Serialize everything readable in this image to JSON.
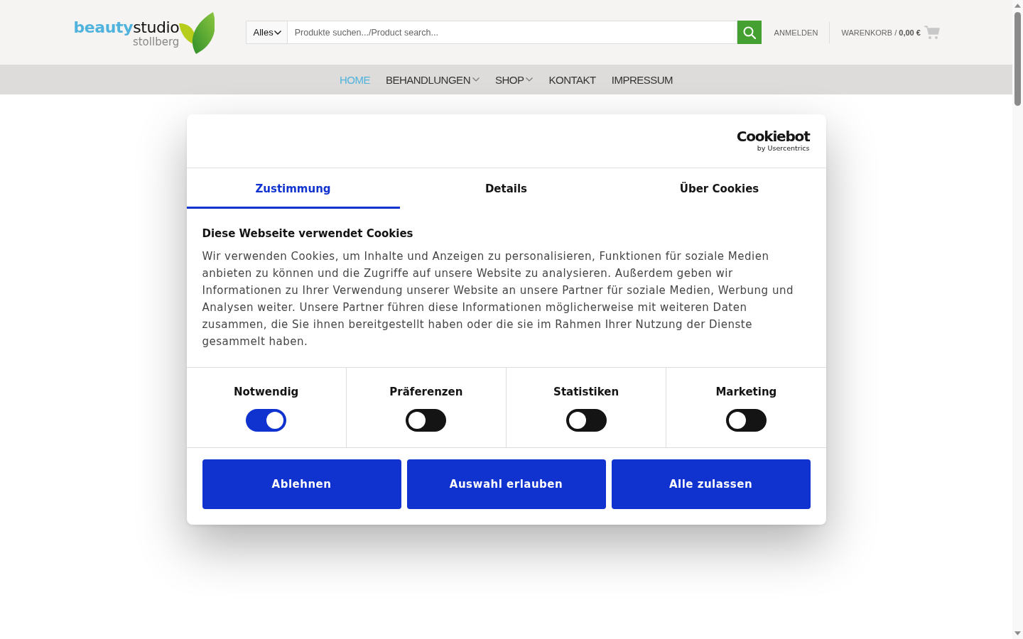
{
  "header": {
    "logo": {
      "wordmark": "**beauty**studio",
      "subtitle": "stollberg"
    },
    "search": {
      "category": "Alles",
      "placeholder": "Produkte suchen.../Product search..."
    },
    "account_link": "ANMELDEN",
    "cart": "WARENKORB / **0,00 €**"
  },
  "nav": [
    {
      "label": "HOME",
      "selected": true,
      "dropdown": false
    },
    {
      "label": "BEHANDLUNGEN",
      "selected": false,
      "dropdown": true
    },
    {
      "label": "SHOP",
      "selected": false,
      "dropdown": true
    },
    {
      "label": "KONTAKT",
      "selected": false,
      "dropdown": false
    },
    {
      "label": "IMPRESSUM",
      "selected": false,
      "dropdown": false
    }
  ],
  "cookie_dialog": {
    "logo": {
      "name": "Cookiebot",
      "byline": "by Usercentrics"
    },
    "tabs": [
      {
        "label": "Zustimmung",
        "selected": true
      },
      {
        "label": "Details",
        "selected": false
      },
      {
        "label": "Über Cookies",
        "selected": false
      }
    ],
    "title": "Diese Webseite verwendet Cookies",
    "text": "Wir verwenden Cookies, um Inhalte und Anzeigen zu personalisieren, Funktionen für soziale Medien anbieten zu können und die Zugriffe auf unsere Website zu analysieren. Außerdem geben wir Informationen zu Ihrer Verwendung unserer Website an unsere Partner für soziale Medien, Werbung und Analysen weiter. Unsere Partner führen diese Informationen möglicherweise mit weiteren Daten zusammen, die Sie ihnen bereitgestellt haben oder die sie im Rahmen Ihrer Nutzung der Dienste gesammelt haben.",
    "categories": [
      {
        "label": "Notwendig",
        "on": true
      },
      {
        "label": "Präferenzen",
        "on": false
      },
      {
        "label": "Statistiken",
        "on": false
      },
      {
        "label": "Marketing",
        "on": false
      }
    ],
    "buttons": [
      "Ablehnen",
      "Auswahl erlauben",
      "Alle zulassen"
    ]
  }
}
